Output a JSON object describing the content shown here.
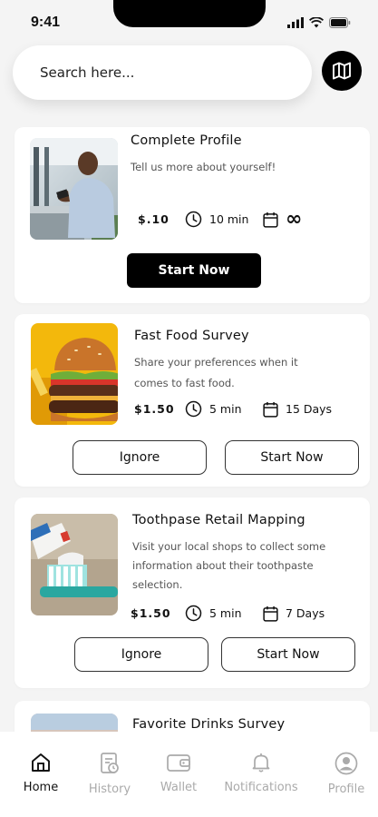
{
  "status_bar": {
    "time": "9:41"
  },
  "search": {
    "placeholder": "Search here..."
  },
  "icons": {
    "map": "map-icon",
    "clock": "clock-icon",
    "calendar": "calendar-icon"
  },
  "surveys": [
    {
      "title": "Complete Profile",
      "description": [
        "Tell us more about yourself!"
      ],
      "price": "$.10",
      "duration": "10 min",
      "days": "∞",
      "start_label": "Start Now"
    },
    {
      "title": "Fast Food Survey",
      "description": [
        "Share your preferences when it",
        "comes to fast food."
      ],
      "price": "$1.50",
      "duration": "5 min",
      "days": "15 Days",
      "ignore_label": "Ignore",
      "start_label": "Start Now"
    },
    {
      "title": "Toothpase Retail Mapping",
      "description": [
        "Visit your local shops to collect some",
        "information about their toothpaste",
        "selection."
      ],
      "price": "$1.50",
      "duration": "5 min",
      "days": "7 Days",
      "ignore_label": "Ignore",
      "start_label": "Start Now"
    },
    {
      "title": "Favorite Drinks Survey"
    }
  ],
  "nav": {
    "items": [
      {
        "label": "Home",
        "icon": "home-icon",
        "active": true
      },
      {
        "label": "History",
        "icon": "history-icon",
        "active": false
      },
      {
        "label": "Wallet",
        "icon": "wallet-icon",
        "active": false
      },
      {
        "label": "Notifications",
        "icon": "bell-icon",
        "active": false
      },
      {
        "label": "Profile",
        "icon": "profile-icon",
        "active": false
      }
    ]
  }
}
